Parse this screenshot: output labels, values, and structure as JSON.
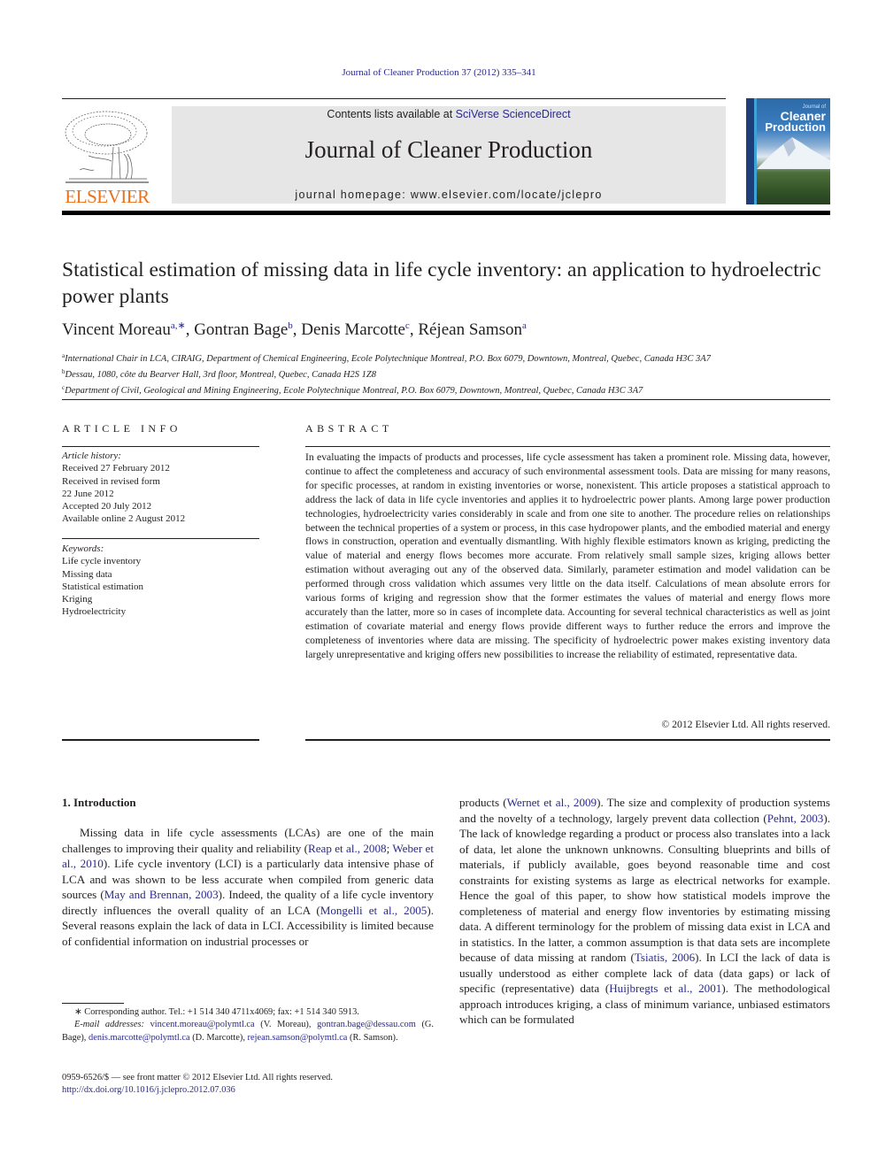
{
  "citation": "Journal of Cleaner Production 37 (2012) 335–341",
  "masthead": {
    "contents_prefix": "Contents lists available at ",
    "contents_link": "SciVerse ScienceDirect",
    "journal_title": "Journal of Cleaner Production",
    "homepage": "journal homepage: www.elsevier.com/locate/jclepro"
  },
  "publisher_logo": {
    "name": "ELSEVIER",
    "color": "#e9711c",
    "icon": "tree-icon"
  },
  "cover": {
    "small": "Journal of",
    "title_line1": "Cleaner",
    "title_line2": "Production",
    "icon": "mountain-icon"
  },
  "article": {
    "title": "Statistical estimation of missing data in life cycle inventory: an application to hydroelectric power plants",
    "authors": [
      {
        "name": "Vincent Moreau",
        "sup": "a,∗",
        "sep": ", "
      },
      {
        "name": "Gontran Bage",
        "sup": "b",
        "sep": ", "
      },
      {
        "name": "Denis Marcotte",
        "sup": "c",
        "sep": ", "
      },
      {
        "name": "Réjean Samson",
        "sup": "a",
        "sep": ""
      }
    ],
    "affiliations": [
      {
        "key": "a",
        "text": "International Chair in LCA, CIRAIG, Department of Chemical Engineering, Ecole Polytechnique Montreal, P.O. Box 6079, Downtown, Montreal, Quebec, Canada H3C 3A7"
      },
      {
        "key": "b",
        "text": "Dessau, 1080, côte du Bearver Hall, 3rd floor, Montreal, Quebec, Canada H2S 1Z8"
      },
      {
        "key": "c",
        "text": "Department of Civil, Geological and Mining Engineering, Ecole Polytechnique Montreal, P.O. Box 6079, Downtown, Montreal, Quebec, Canada H3C 3A7"
      }
    ]
  },
  "article_info": {
    "heading": "ARTICLE INFO",
    "history_label": "Article history:",
    "history": [
      "Received 27 February 2012",
      "Received in revised form",
      "22 June 2012",
      "Accepted 20 July 2012",
      "Available online 2 August 2012"
    ],
    "keywords_label": "Keywords:",
    "keywords": [
      "Life cycle inventory",
      "Missing data",
      "Statistical estimation",
      "Kriging",
      "Hydroelectricity"
    ]
  },
  "abstract": {
    "heading": "ABSTRACT",
    "text": "In evaluating the impacts of products and processes, life cycle assessment has taken a prominent role. Missing data, however, continue to affect the completeness and accuracy of such environmental assessment tools. Data are missing for many reasons, for specific processes, at random in existing inventories or worse, nonexistent. This article proposes a statistical approach to address the lack of data in life cycle inventories and applies it to hydroelectric power plants. Among large power production technologies, hydroelectricity varies considerably in scale and from one site to another. The procedure relies on relationships between the technical properties of a system or process, in this case hydropower plants, and the embodied material and energy flows in construction, operation and eventually dismantling. With highly flexible estimators known as kriging, predicting the value of material and energy flows becomes more accurate. From relatively small sample sizes, kriging allows better estimation without averaging out any of the observed data. Similarly, parameter estimation and model validation can be performed through cross validation which assumes very little on the data itself. Calculations of mean absolute errors for various forms of kriging and regression show that the former estimates the values of material and energy flows more accurately than the latter, more so in cases of incomplete data. Accounting for several technical characteristics as well as joint estimation of covariate material and energy flows provide different ways to further reduce the errors and improve the completeness of inventories where data are missing. The specificity of hydroelectric power makes existing inventory data largely unrepresentative and kriging offers new possibilities to increase the reliability of estimated, representative data.",
    "copyright": "© 2012 Elsevier Ltd. All rights reserved."
  },
  "introduction": {
    "heading": "1.  Introduction",
    "left_segments": [
      {
        "t": "Missing data in life cycle assessments (LCAs) are one of the main challenges to improving their quality and reliability ("
      },
      {
        "link": "Reap et al., 2008"
      },
      {
        "t": "; "
      },
      {
        "link": "Weber et al., 2010"
      },
      {
        "t": "). Life cycle inventory (LCI) is a particularly data intensive phase of LCA and was shown to be less accurate when compiled from generic data sources ("
      },
      {
        "link": "May and Brennan, 2003"
      },
      {
        "t": "). Indeed, the quality of a life cycle inventory directly influences the overall quality of an LCA ("
      },
      {
        "link": "Mongelli et al., 2005"
      },
      {
        "t": "). Several reasons explain the lack of data in LCI. Accessibility is limited because of confidential information on industrial processes or"
      }
    ],
    "right_segments": [
      {
        "t": "products ("
      },
      {
        "link": "Wernet et al., 2009"
      },
      {
        "t": "). The size and complexity of production systems and the novelty of a technology, largely prevent data collection ("
      },
      {
        "link": "Pehnt, 2003"
      },
      {
        "t": "). The lack of knowledge regarding a product or process also translates into a lack of data, let alone the unknown unknowns. Consulting blueprints and bills of materials, if publicly available, goes beyond reasonable time and cost constraints for existing systems as large as electrical networks for example. Hence the goal of this paper, to show how statistical models improve the completeness of material and energy flow inventories by estimating missing data. A different terminology for the problem of missing data exist in LCA and in statistics. In the latter, a common assumption is that data sets are incomplete because of data missing at random ("
      },
      {
        "link": "Tsiatis, 2006"
      },
      {
        "t": "). In LCI the lack of data is usually understood as either complete lack of data (data gaps) or lack of specific (representative) data ("
      },
      {
        "link": "Huijbregts et al., 2001"
      },
      {
        "t": "). The methodological approach introduces kriging, a class of minimum variance, unbiased estimators which can be formulated"
      }
    ]
  },
  "footnotes": {
    "corresponding": "∗  Corresponding author. Tel.: +1 514 340 4711x4069; fax: +1 514 340 5913.",
    "email_label": "E-mail addresses:",
    "emails": [
      {
        "email": "vincent.moreau@polymtl.ca",
        "who": " (V. Moreau), "
      },
      {
        "email": "gontran.bage@dessau.com",
        "who": " (G. Bage), "
      },
      {
        "email": "denis.marcotte@polymtl.ca",
        "who": " (D. Marcotte), "
      },
      {
        "email": "rejean.samson@polymtl.ca",
        "who": " (R. Samson)."
      }
    ],
    "issn": "0959-6526/$ — see front matter © 2012 Elsevier Ltd. All rights reserved.",
    "doi": "http://dx.doi.org/10.1016/j.jclepro.2012.07.036"
  },
  "colors": {
    "link": "#2a2a8c",
    "text": "#231f20",
    "masthead_bg": "#e6e6e6",
    "elsevier_orange": "#e9711c"
  }
}
